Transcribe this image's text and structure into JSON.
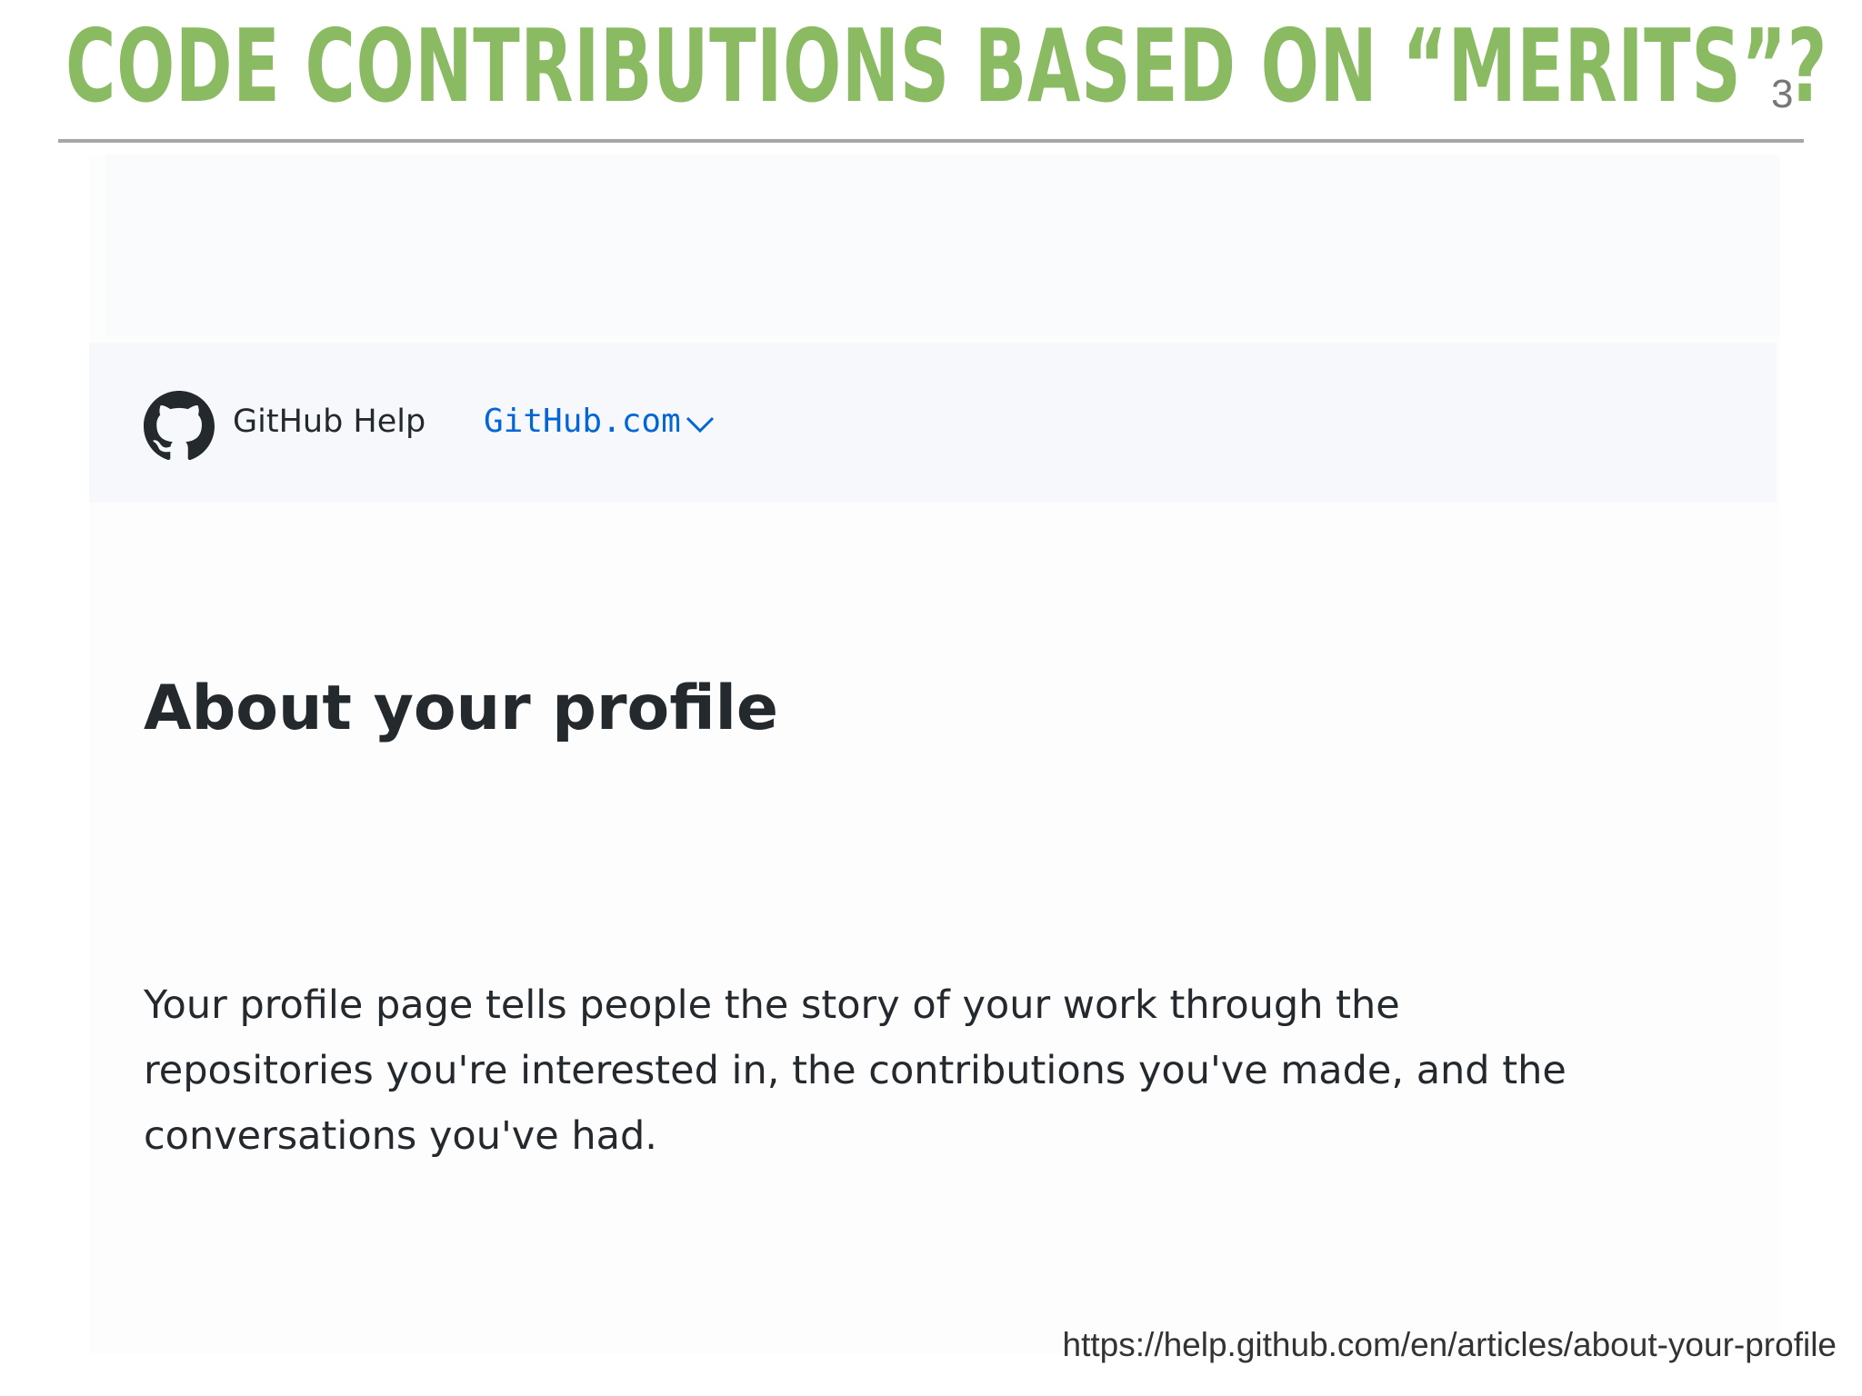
{
  "slide": {
    "title": "CODE CONTRIBUTIONS BASED ON “MERITS”?",
    "number": "3",
    "source_url": "https://help.github.com/en/articles/about-your-profile"
  },
  "screenshot": {
    "header": {
      "logo_icon": "github-octocat-icon",
      "site_title": "GitHub Help",
      "product_selector": "GitHub.com",
      "selector_icon": "chevron-down-icon"
    },
    "article": {
      "heading": "About your profile",
      "intro_lines": [
        "Your profile page tells people the story of your work through the",
        "repositories you're interested in, the contributions you've made, and the",
        "conversations you've had."
      ]
    }
  },
  "colors": {
    "title_green": "#8aba62",
    "link_blue": "#0366d6",
    "text_dark": "#24292e"
  }
}
